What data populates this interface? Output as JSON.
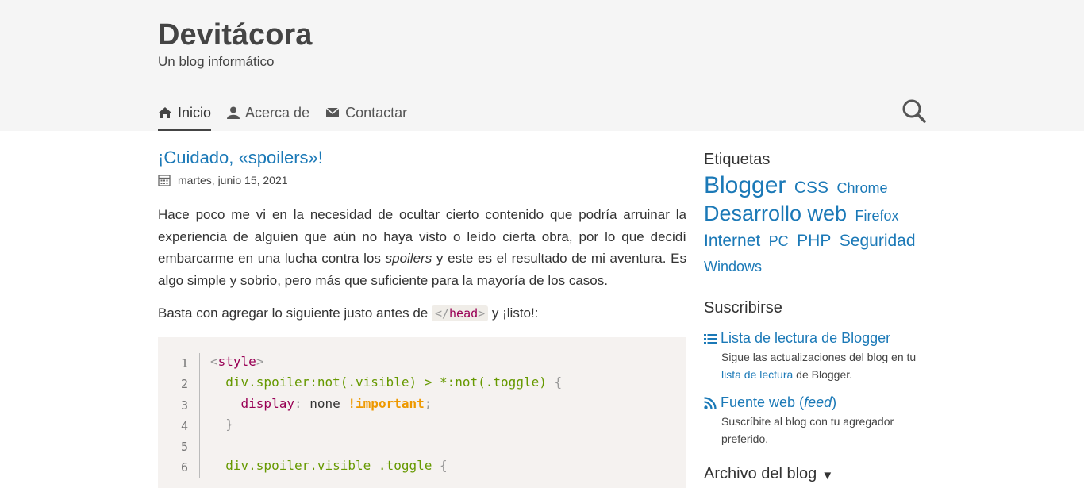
{
  "site": {
    "title": "Devitácora",
    "description": "Un blog informático"
  },
  "nav": {
    "items": [
      {
        "label": "Inicio",
        "icon": "home-icon"
      },
      {
        "label": "Acerca de",
        "icon": "user-icon"
      },
      {
        "label": "Contactar",
        "icon": "envelope-icon"
      }
    ]
  },
  "post": {
    "title": "¡Cuidado, «spoilers»!",
    "date": "martes, junio 15, 2021",
    "p1_a": "Hace poco me vi en la necesidad de ocultar cierto contenido que podría arruinar la experiencia de alguien que aún no haya visto o leído cierta obra, por lo que decidí embarcarme en una lucha contra los ",
    "p1_em": "spoilers",
    "p1_b": " y este es el resultado de mi aventura. Es algo simple y sobrio, pero más que suficiente para la mayoría de los casos.",
    "p2_a": "Basta con agregar lo siguiente justo antes de ",
    "p2_code_punct": "</",
    "p2_code_tag": "head",
    "p2_code_end": ">",
    "p2_b": " y ¡listo!:"
  },
  "code": {
    "line_numbers": [
      "1",
      "2",
      "3",
      "4",
      "5",
      "6"
    ],
    "l1_open": "<",
    "l1_tag": "style",
    "l1_close": ">",
    "l2_sel": "  div.spoiler:not(.visible) > *:not(.toggle) ",
    "l2_brace": "{",
    "l3_indent": "    ",
    "l3_prop": "display",
    "l3_colon": ":",
    "l3_val": " none ",
    "l3_imp": "!important",
    "l3_semi": ";",
    "l4_brace": "  }",
    "l6_sel": "  div.spoiler.visible .toggle ",
    "l6_brace": "{"
  },
  "sidebar": {
    "labels_heading": "Etiquetas",
    "tags": [
      {
        "label": "Blogger",
        "size": "xl"
      },
      {
        "label": "CSS",
        "size": "m"
      },
      {
        "label": "Chrome",
        "size": "s"
      },
      {
        "label": "Desarrollo web",
        "size": "xl"
      },
      {
        "label": "Firefox",
        "size": "s"
      },
      {
        "label": "Internet",
        "size": "m"
      },
      {
        "label": "PC",
        "size": "s"
      },
      {
        "label": "PHP",
        "size": "m"
      },
      {
        "label": "Seguridad",
        "size": "m"
      },
      {
        "label": "Windows",
        "size": "s"
      }
    ],
    "subscribe_heading": "Suscribirse",
    "reading_list": {
      "label": "Lista de lectura de Blogger",
      "desc_a": "Sigue las actualizaciones del blog en tu ",
      "desc_link": "lista de lectura",
      "desc_b": " de Blogger."
    },
    "feed": {
      "label_a": "Fuente web (",
      "label_em": "feed",
      "label_b": ")",
      "desc": "Suscríbite al blog con tu agregador preferido."
    },
    "archive_heading": "Archivo del blog",
    "archive_arrow": "▼"
  },
  "colors": {
    "link": "#1b79b7",
    "header_bg": "#f5f5f5",
    "code_bg": "#f5f2f0"
  }
}
